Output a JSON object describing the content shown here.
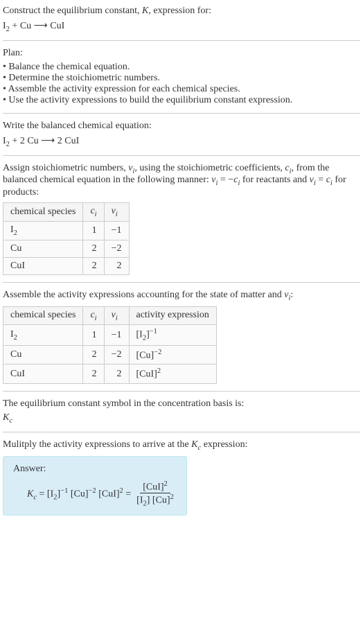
{
  "intro": {
    "line1_a": "Construct the equilibrium constant, ",
    "line1_k": "K",
    "line1_b": ", expression for:",
    "eq_lhs1": "I",
    "eq_sub1": "2",
    "eq_plus": " + Cu ",
    "eq_arrow": "⟶",
    "eq_rhs": " CuI"
  },
  "plan": {
    "heading": "Plan:",
    "b1": "• Balance the chemical equation.",
    "b2": "• Determine the stoichiometric numbers.",
    "b3": "• Assemble the activity expression for each chemical species.",
    "b4": "• Use the activity expressions to build the equilibrium constant expression."
  },
  "balanced": {
    "heading": "Write the balanced chemical equation:",
    "eq_a": "I",
    "eq_sub": "2",
    "eq_b": " + 2 Cu ",
    "eq_arrow": "⟶",
    "eq_c": " 2 CuI"
  },
  "stoich": {
    "text_a": "Assign stoichiometric numbers, ",
    "nu": "ν",
    "sub_i": "i",
    "text_b": ", using the stoichiometric coefficients, ",
    "c": "c",
    "text_c": ", from the balanced chemical equation in the following manner: ",
    "rel1_a": "ν",
    "rel1_b": " = −",
    "rel1_c": "c",
    "text_d": " for reactants and ",
    "rel2_a": "ν",
    "rel2_b": " = ",
    "rel2_c": "c",
    "text_e": " for products:"
  },
  "table1": {
    "h1": "chemical species",
    "h2_a": "c",
    "h2_b": "i",
    "h3_a": "ν",
    "h3_b": "i",
    "rows": [
      {
        "sp_a": "I",
        "sp_sub": "2",
        "sp_b": "",
        "c": "1",
        "nu": "−1"
      },
      {
        "sp_a": "Cu",
        "sp_sub": "",
        "sp_b": "",
        "c": "2",
        "nu": "−2"
      },
      {
        "sp_a": "CuI",
        "sp_sub": "",
        "sp_b": "",
        "c": "2",
        "nu": "2"
      }
    ]
  },
  "activity": {
    "text_a": "Assemble the activity expressions accounting for the state of matter and ",
    "nu": "ν",
    "sub_i": "i",
    "text_b": ":"
  },
  "table2": {
    "h1": "chemical species",
    "h2_a": "c",
    "h2_b": "i",
    "h3_a": "ν",
    "h3_b": "i",
    "h4": "activity expression",
    "rows": [
      {
        "sp_a": "I",
        "sp_sub": "2",
        "c": "1",
        "nu": "−1",
        "ae_a": "[I",
        "ae_sub": "2",
        "ae_b": "]",
        "ae_sup": "−1"
      },
      {
        "sp_a": "Cu",
        "sp_sub": "",
        "c": "2",
        "nu": "−2",
        "ae_a": "[Cu",
        "ae_sub": "",
        "ae_b": "]",
        "ae_sup": "−2"
      },
      {
        "sp_a": "CuI",
        "sp_sub": "",
        "c": "2",
        "nu": "2",
        "ae_a": "[CuI",
        "ae_sub": "",
        "ae_b": "]",
        "ae_sup": "2"
      }
    ]
  },
  "symbol": {
    "text": "The equilibrium constant symbol in the concentration basis is:",
    "kc_a": "K",
    "kc_b": "c"
  },
  "multiply": {
    "text_a": "Mulitply the activity expressions to arrive at the ",
    "kc_a": "K",
    "kc_b": "c",
    "text_b": " expression:"
  },
  "answer": {
    "label": "Answer:",
    "kc_a": "K",
    "kc_b": "c",
    "eq": " = ",
    "t1_a": "[I",
    "t1_sub": "2",
    "t1_b": "]",
    "t1_sup": "−1",
    "t2_a": " [Cu]",
    "t2_sup": "−2",
    "t3_a": " [CuI]",
    "t3_sup": "2",
    "eq2": " = ",
    "frac_top_a": "[CuI]",
    "frac_top_sup": "2",
    "frac_bot_a": "[I",
    "frac_bot_sub": "2",
    "frac_bot_b": "] [Cu]",
    "frac_bot_sup": "2"
  }
}
